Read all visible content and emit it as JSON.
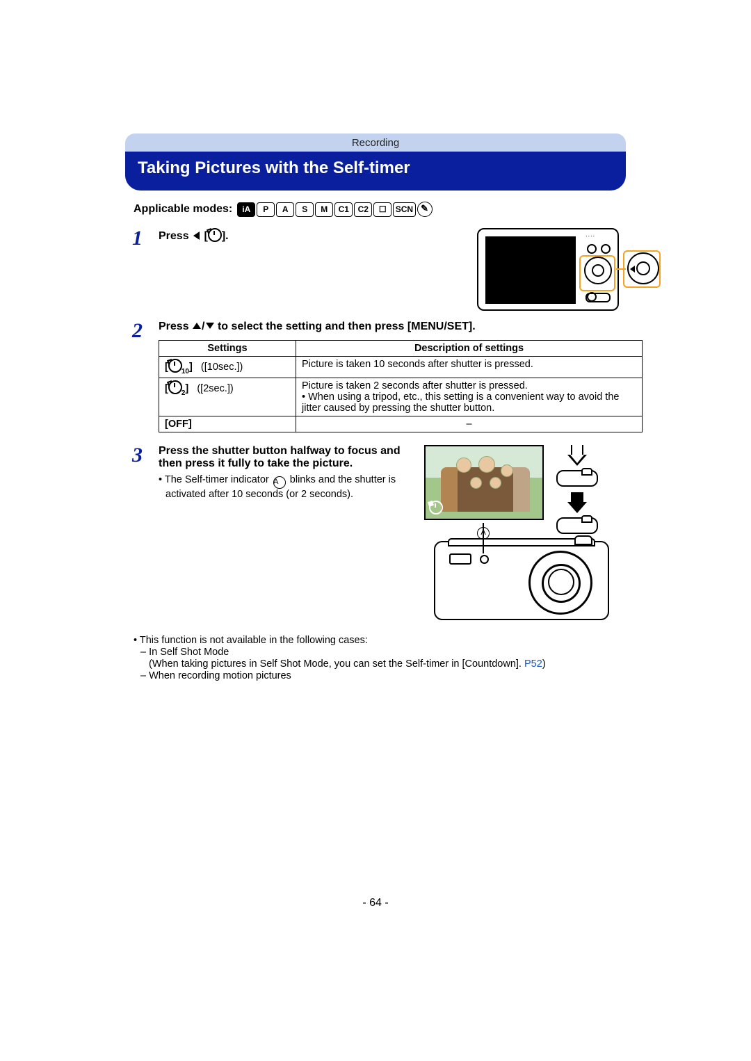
{
  "header": {
    "section": "Recording",
    "title": "Taking Pictures with the Self-timer"
  },
  "modes": {
    "label": "Applicable modes:",
    "items": [
      "iA",
      "P",
      "A",
      "S",
      "M",
      "C1",
      "C2",
      "☐",
      "SCN",
      "✎"
    ]
  },
  "steps": {
    "s1": {
      "prefix": "Press",
      "suffix": "."
    },
    "s2": {
      "prefix": "Press",
      "mid": "to select the setting and then press",
      "button": "[MENU/SET]",
      "suffix": "."
    },
    "s3": {
      "text": "Press the shutter button halfway to focus and then press it fully to take the picture.",
      "bullet_a": "The Self-timer indicator",
      "bullet_b": "blinks and the shutter is activated after 10 seconds (or 2 seconds)."
    }
  },
  "table": {
    "head": {
      "col1": "Settings",
      "col2": "Description of settings"
    },
    "rows": [
      {
        "icon_sub": "10",
        "setting": "([10sec.])",
        "desc": "Picture is taken 10 seconds after shutter is pressed."
      },
      {
        "icon_sub": "2",
        "setting": "([2sec.])",
        "desc_line1": "Picture is taken 2 seconds after shutter is pressed.",
        "desc_line2": "When using a tripod, etc., this setting is a convenient way to avoid the jitter caused by pressing the shutter button."
      },
      {
        "setting": "[OFF]",
        "desc": "–"
      }
    ]
  },
  "notes": {
    "intro": "This function is not available in the following cases:",
    "n1": "In Self Shot Mode",
    "n1_paren_a": "(When taking pictures in Self Shot Mode, you can set the Self-timer in [Countdown].",
    "n1_link": "P52",
    "n1_paren_b": ")",
    "n2": "When recording motion pictures"
  },
  "figures": {
    "label_a": "A"
  },
  "page": {
    "number": "- 64 -"
  }
}
